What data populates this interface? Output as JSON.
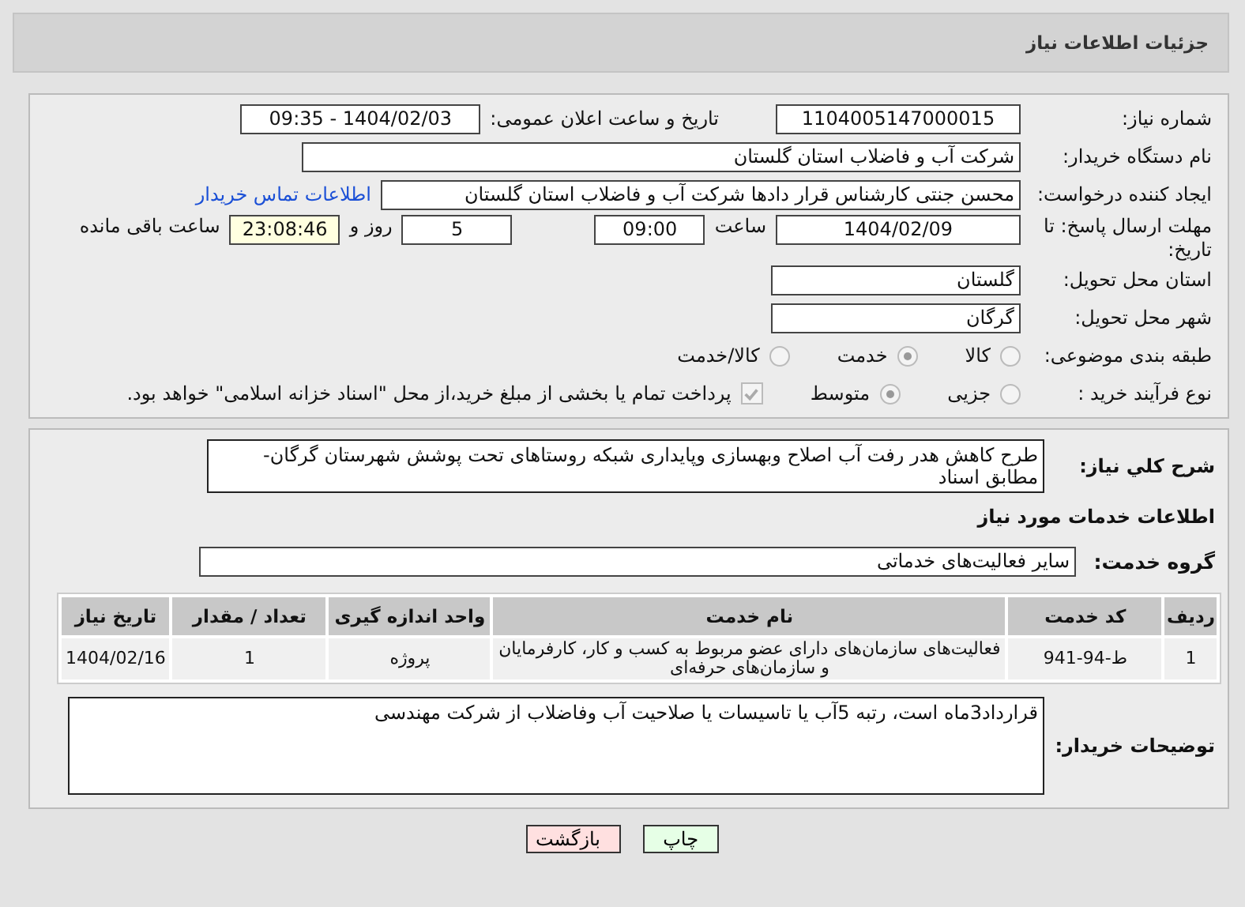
{
  "header": {
    "title": "جزئیات اطلاعات نیاز"
  },
  "need_number": {
    "label": "شماره نیاز:",
    "value": "1104005147000015"
  },
  "announce": {
    "label": "تاریخ و ساعت اعلان عمومی:",
    "value": "1404/02/03 - 09:35"
  },
  "buyer": {
    "label": "نام دستگاه خریدار:",
    "value": "شرکت آب و فاضلاب استان گلستان"
  },
  "requester": {
    "label": "ایجاد کننده درخواست:",
    "value": "محسن جنتی کارشناس قرار دادها شرکت آب و فاضلاب استان گلستان",
    "link": "اطلاعات تماس خریدار"
  },
  "deadline": {
    "label": "مهلت ارسال پاسخ: تا تاریخ:",
    "date": "1404/02/09",
    "time_label": "ساعت",
    "time": "09:00",
    "days": "5",
    "days_label": "روز و",
    "remaining": "23:08:46",
    "remaining_label": "ساعت باقی مانده"
  },
  "province": {
    "label": "استان محل تحویل:",
    "value": "گلستان"
  },
  "city": {
    "label": "شهر محل تحویل:",
    "value": "گرگان"
  },
  "category": {
    "label": "طبقه بندی موضوعی:",
    "options": [
      {
        "label": "کالا",
        "selected": false
      },
      {
        "label": "خدمت",
        "selected": true
      },
      {
        "label": "کالا/خدمت",
        "selected": false
      }
    ]
  },
  "process": {
    "label": "نوع فرآیند خرید :",
    "options": [
      {
        "label": "جزیی",
        "selected": false
      },
      {
        "label": "متوسط",
        "selected": true
      }
    ],
    "payment": {
      "label": "پرداخت تمام یا بخشی از مبلغ خرید،از محل \"اسناد خزانه اسلامی\" خواهد بود.",
      "checked": true
    }
  },
  "description": {
    "label": "شرح کلي نياز:",
    "value": "طرح کاهش هدر رفت آب اصلاح وبهسازی وپایداری شبکه روستاهای تحت پوشش شهرستان گرگان-مطابق اسناد"
  },
  "services": {
    "title": "اطلاعات خدمات مورد نیاز",
    "group_label": "گروه خدمت:",
    "group": "سایر فعالیت‌های خدماتی",
    "table": {
      "columns": [
        "ردیف",
        "کد خدمت",
        "نام خدمت",
        "واحد اندازه گیری",
        "تعداد / مقدار",
        "تاریخ نیاز"
      ],
      "rows": [
        [
          "1",
          "ط-94-941",
          "فعالیت‌های سازمان‌های دارای عضو مربوط به کسب و کار، کارفرمایان و سازمان‌های حرفه‌ای",
          "پروژه",
          "1",
          "1404/02/16"
        ]
      ]
    }
  },
  "notes": {
    "label": "توضیحات خریدار:",
    "value": "قرارداد3ماه است، رتبه 5آب یا تاسیسات یا صلاحیت آب وفاضلاب از شرکت مهندسی"
  },
  "buttons": [
    {
      "label": "چاپ",
      "kind": "print"
    },
    {
      "label": "بازگشت",
      "kind": "back"
    }
  ]
}
